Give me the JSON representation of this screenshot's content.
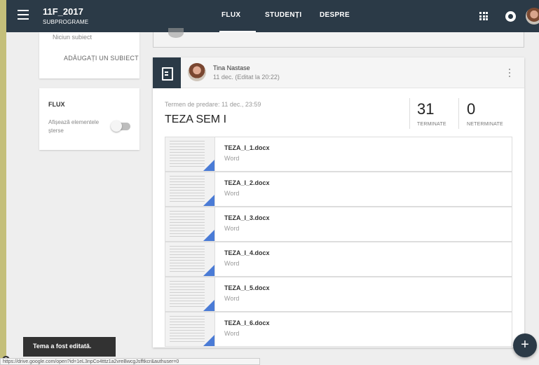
{
  "topbar": {
    "class_title": "11F_2017",
    "class_subtitle": "SUBPROGRAME",
    "tabs": [
      {
        "label": "FLUX",
        "active": true
      },
      {
        "label": "STUDENȚI",
        "active": false
      },
      {
        "label": "DESPRE",
        "active": false
      }
    ],
    "icons": [
      "menu-icon",
      "apps-grid-icon",
      "notifications-icon",
      "avatar"
    ]
  },
  "sidebar": {
    "topics": {
      "empty_text": "Niciun subiect",
      "add_label": "ADĂUGAȚI UN SUBIECT"
    },
    "flux": {
      "title": "FLUX",
      "toggle_label": "Afișează elementele șterse",
      "toggle_on": false
    }
  },
  "post": {
    "author": "Tina Nastase",
    "date": "11 dec. (Editat la 20:22)",
    "deadline": "Termen de predare: 11 dec., 23:59",
    "title": "TEZA SEM I",
    "stats": [
      {
        "value": "31",
        "label": "TERMINATE"
      },
      {
        "value": "0",
        "label": "NETERMINATE"
      }
    ],
    "attachments": [
      {
        "name": "TEZA_I_1.docx",
        "type": "Word"
      },
      {
        "name": "TEZA_I_2.docx",
        "type": "Word"
      },
      {
        "name": "TEZA_I_3.docx",
        "type": "Word"
      },
      {
        "name": "TEZA_I_4.docx",
        "type": "Word"
      },
      {
        "name": "TEZA_I_5.docx",
        "type": "Word"
      },
      {
        "name": "TEZA_I_6.docx",
        "type": "Word"
      }
    ]
  },
  "toast": {
    "text": "Tema a fost editată."
  },
  "help": {
    "label": "?"
  },
  "statusbar": {
    "url": "https://drive.google.com/open?id=1eL3npCo4tttz1a2vreBwcgJsfftkcr&authuser=0"
  },
  "fab": {
    "label": "+"
  },
  "colors": {
    "header": "#2b3a47",
    "accent_file": "#4a7bd6",
    "background": "#eeeeee"
  }
}
